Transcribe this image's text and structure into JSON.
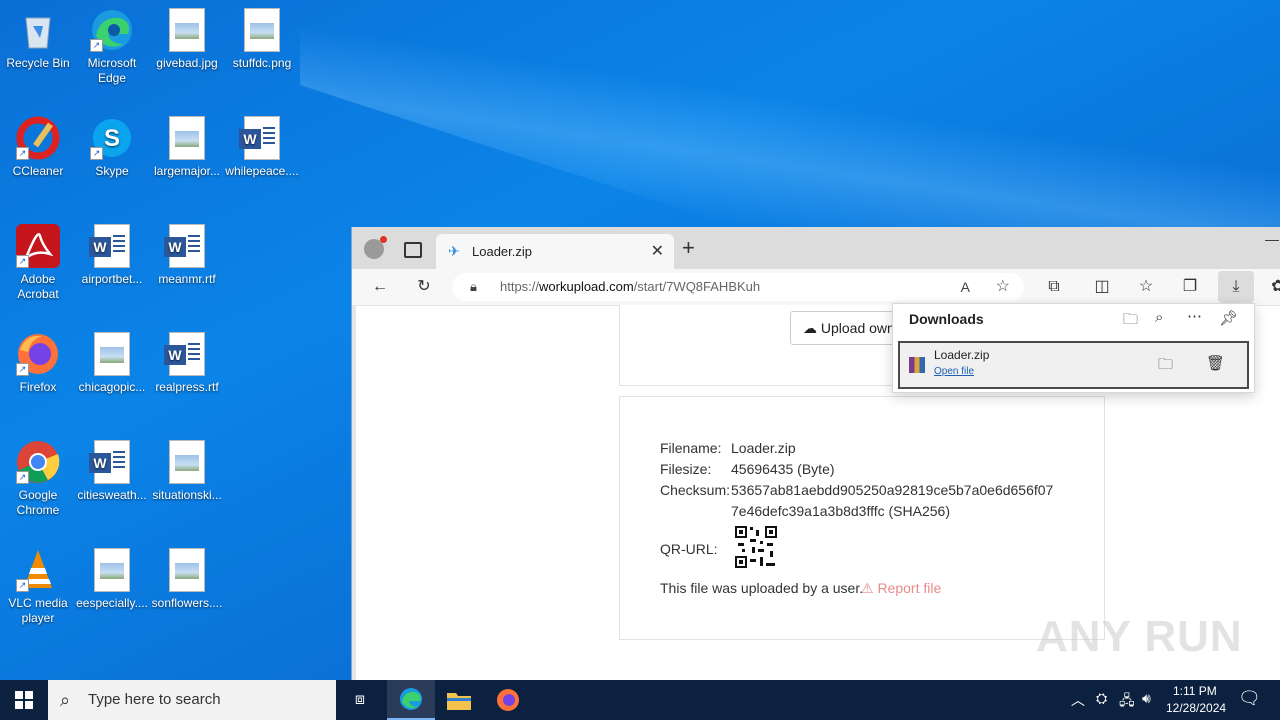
{
  "desktop": {
    "icons": [
      {
        "label": "Recycle Bin"
      },
      {
        "label": "Microsoft Edge"
      },
      {
        "label": "givebad.jpg"
      },
      {
        "label": "stuffdc.png"
      },
      {
        "label": "CCleaner"
      },
      {
        "label": "Skype"
      },
      {
        "label": "largemajor..."
      },
      {
        "label": "whilepeace...."
      },
      {
        "label": "Adobe Acrobat"
      },
      {
        "label": "airportbet..."
      },
      {
        "label": "meanmr.rtf"
      },
      {
        "label": "Firefox"
      },
      {
        "label": "chicagopic..."
      },
      {
        "label": "realpress.rtf"
      },
      {
        "label": "Google Chrome"
      },
      {
        "label": "citiesweath..."
      },
      {
        "label": "situationski..."
      },
      {
        "label": "VLC media player"
      },
      {
        "label": "eespecially...."
      },
      {
        "label": "sonflowers...."
      }
    ]
  },
  "browser": {
    "tab_title": "Loader.zip",
    "url_prefix": "https://",
    "url_host": "workupload.com",
    "url_path": "/start/7WQ8FAHBKuh",
    "upload_button": "Upload own",
    "file": {
      "filename_label": "Filename:",
      "filename": "Loader.zip",
      "filesize_label": "Filesize:",
      "filesize": "45696435 (Byte)",
      "checksum_label": "Checksum:",
      "checksum_line1": "53657ab81aebdd905250a92819ce5b7a0e6d656f07",
      "checksum_line2": "7e46defc39a1a3b8d3fffc (SHA256)",
      "qr_label": "QR-URL:",
      "uploaded_by": "This file was uploaded by a user.",
      "report": "Report file"
    },
    "downloads": {
      "title": "Downloads",
      "item_name": "Loader.zip",
      "item_action": "Open file"
    }
  },
  "taskbar": {
    "search_placeholder": "Type here to search",
    "time": "1:11 PM",
    "date": "12/28/2024"
  },
  "watermark": "ANY RUN"
}
